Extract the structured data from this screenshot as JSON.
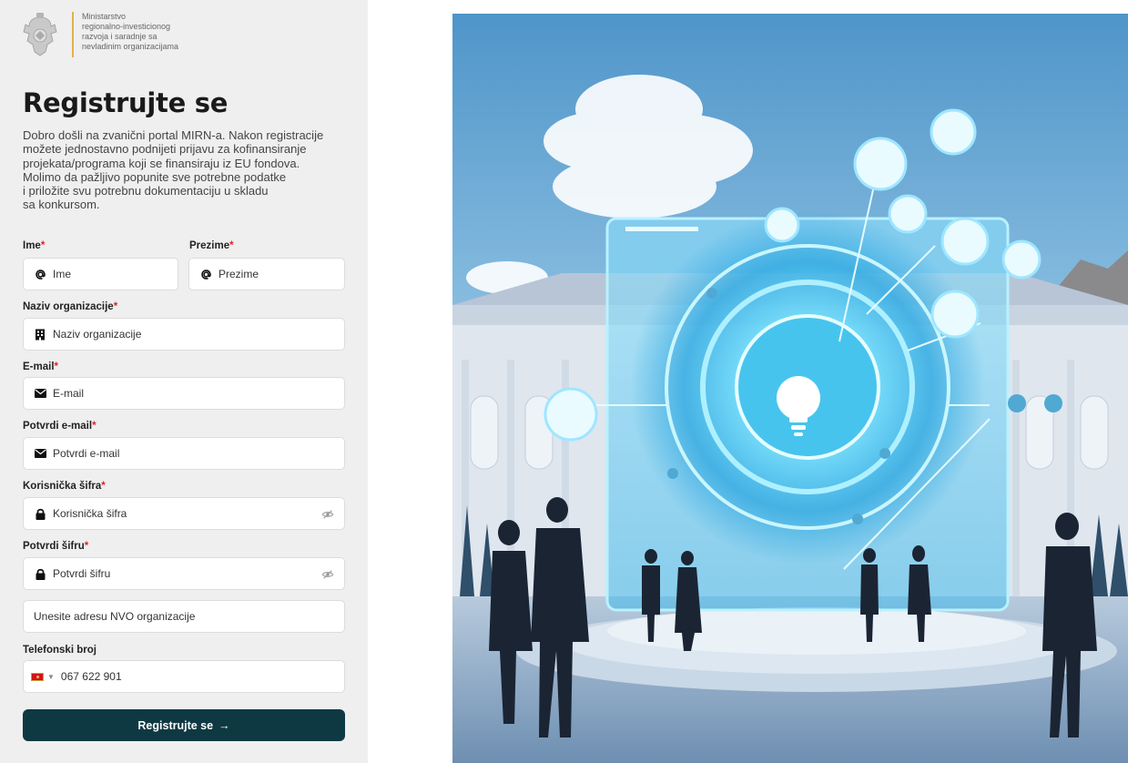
{
  "header": {
    "ministry_lines": [
      "Ministarstvo",
      "regionalno-investicionog",
      "razvoja i saradnje sa",
      "nevladinim organizacijama"
    ]
  },
  "page": {
    "title": "Registrujte se",
    "intro_lines": [
      "Dobro došli na zvanični portal MIRN-a. Nakon registracije",
      "možete jednostavno podnijeti prijavu za kofinansiranje",
      "projekata/programa koji se finansiraju iz EU fondova.",
      "Molimo da pažljivo popunite sve potrebne podatke",
      "i priložite svu potrebnu dokumentaciju u skladu",
      "sa konkursom."
    ]
  },
  "form": {
    "first_name": {
      "label": "Ime",
      "required": "*",
      "placeholder": "Ime",
      "icon": "at-icon"
    },
    "last_name": {
      "label": "Prezime",
      "required": "*",
      "placeholder": "Prezime",
      "icon": "at-icon"
    },
    "organization": {
      "label": "Naziv organizacije",
      "required": "*",
      "placeholder": "Naziv organizacije",
      "icon": "building-icon"
    },
    "email": {
      "label": "E-mail",
      "required": "*",
      "placeholder": "E-mail",
      "icon": "envelope-icon"
    },
    "confirm_email": {
      "label": "Potvrdi e-mail",
      "required": "*",
      "placeholder": "Potvrdi e-mail",
      "icon": "envelope-icon"
    },
    "password": {
      "label": "Korisnička šifra",
      "required": "*",
      "placeholder": "Korisnička šifra",
      "icon": "lock-icon"
    },
    "confirm_password": {
      "label": "Potvrdi šifru",
      "required": "*",
      "placeholder": "Potvrdi šifru",
      "icon": "lock-icon"
    },
    "address": {
      "placeholder": "Unesite adresu NVO organizacije"
    },
    "phone": {
      "label": "Telefonski broj",
      "value": "067 622 901",
      "icon": "montenegro-flag-icon"
    },
    "submit_label": "Registrujte se",
    "submit_arrow": "→"
  },
  "colors": {
    "primary_button": "#0f3942",
    "required_asterisk": "#e02424",
    "accent_line": "#e0b34a",
    "panel_background": "#efefef"
  }
}
